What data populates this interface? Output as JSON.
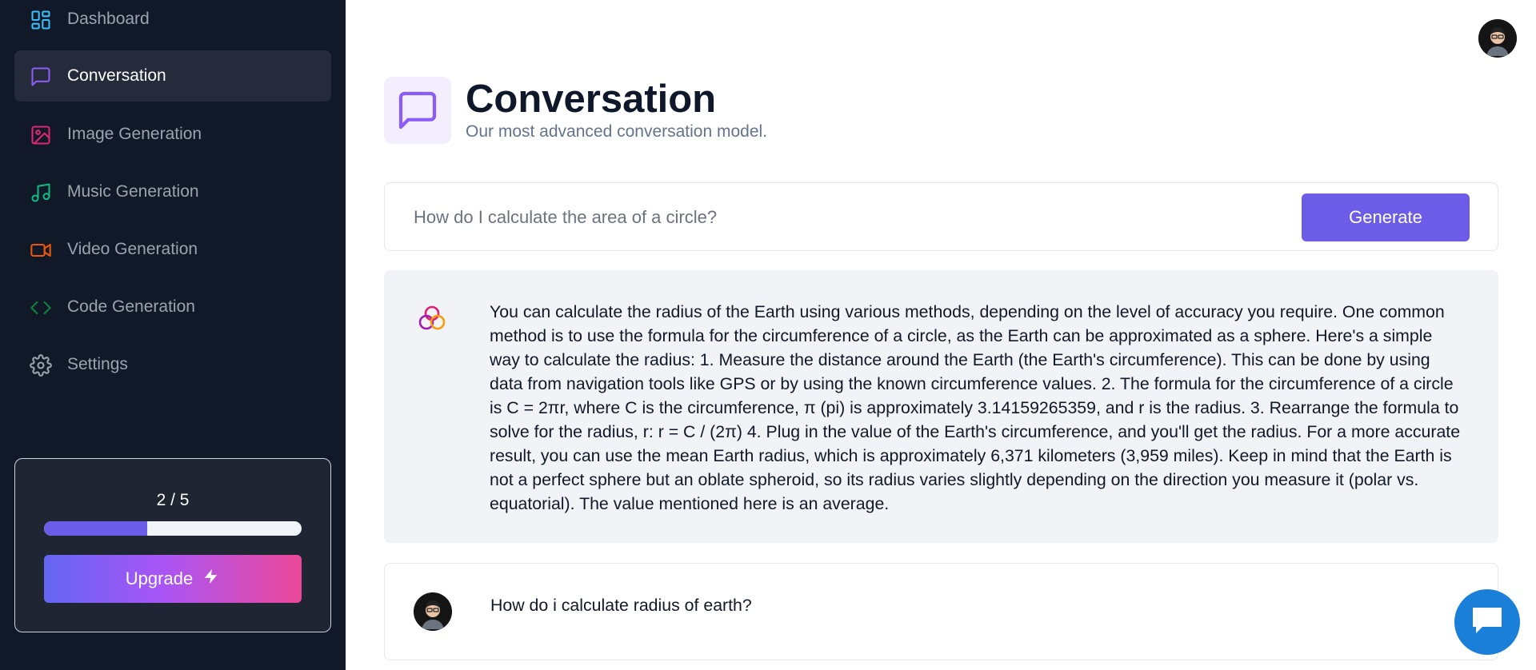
{
  "sidebar": {
    "items": [
      {
        "label": "Dashboard",
        "icon": "dashboard-icon",
        "color": "#38bdf8",
        "active": false
      },
      {
        "label": "Conversation",
        "icon": "message-square-icon",
        "color": "#8b5cf6",
        "active": true
      },
      {
        "label": "Image Generation",
        "icon": "image-icon",
        "color": "#db2777",
        "active": false
      },
      {
        "label": "Music Generation",
        "icon": "music-icon",
        "color": "#10b981",
        "active": false
      },
      {
        "label": "Video Generation",
        "icon": "video-icon",
        "color": "#ea580c",
        "active": false
      },
      {
        "label": "Code Generation",
        "icon": "code-icon",
        "color": "#15803d",
        "active": false
      },
      {
        "label": "Settings",
        "icon": "gear-icon",
        "color": "#9ca3af",
        "active": false
      }
    ],
    "usage": {
      "count_text": "2 / 5",
      "used": 2,
      "limit": 5,
      "progress_fraction": 0.4,
      "upgrade_label": "Upgrade"
    }
  },
  "header": {
    "title": "Conversation",
    "subtitle": "Our most advanced conversation model.",
    "icon": "message-square-icon",
    "accent_color": "#8b5cf6"
  },
  "prompt": {
    "placeholder": "How do I calculate the area of a circle?",
    "value": "",
    "generate_label": "Generate"
  },
  "messages": [
    {
      "role": "bot",
      "icon": "bot-logo-icon",
      "text": "You can calculate the radius of the Earth using various methods, depending on the level of accuracy you require. One common method is to use the formula for the circumference of a circle, as the Earth can be approximated as a sphere. Here's a simple way to calculate the radius: 1. Measure the distance around the Earth (the Earth's circumference). This can be done by using data from navigation tools like GPS or by using the known circumference values. 2. The formula for the circumference of a circle is C = 2πr, where C is the circumference, π (pi) is approximately 3.14159265359, and r is the radius. 3. Rearrange the formula to solve for the radius, r: r = C / (2π) 4. Plug in the value of the Earth's circumference, and you'll get the radius. For a more accurate result, you can use the mean Earth radius, which is approximately 6,371 kilometers (3,959 miles). Keep in mind that the Earth is not a perfect sphere but an oblate spheroid, so its radius varies slightly depending on the direction you measure it (polar vs. equatorial). The value mentioned here is an average."
    },
    {
      "role": "user",
      "icon": "user-avatar",
      "text": "How do i calculate radius of earth?"
    }
  ],
  "colors": {
    "sidebar_bg": "#111827",
    "primary": "#6c5ce7",
    "chat_fab": "#1a7fd9"
  }
}
